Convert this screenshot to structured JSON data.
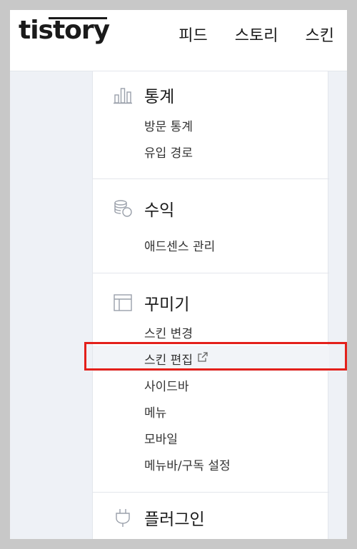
{
  "header": {
    "logo": "tistory",
    "nav": [
      "피드",
      "스토리",
      "스킨"
    ]
  },
  "sidebar": {
    "sections": [
      {
        "title": "통계",
        "icon": "bar-chart-icon",
        "items": [
          "방문 통계",
          "유입 경로"
        ]
      },
      {
        "title": "수익",
        "icon": "coins-icon",
        "items": [
          "애드센스 관리"
        ]
      },
      {
        "title": "꾸미기",
        "icon": "layout-icon",
        "items": [
          "스킨 변경",
          "스킨 편집",
          "사이드바",
          "메뉴",
          "모바일",
          "메뉴바/구독 설정"
        ]
      },
      {
        "title": "플러그인",
        "icon": "plug-icon",
        "items": []
      }
    ],
    "active_item": "스킨 편집"
  },
  "colors": {
    "highlight": "#e3201b",
    "background": "#eef1f6"
  }
}
